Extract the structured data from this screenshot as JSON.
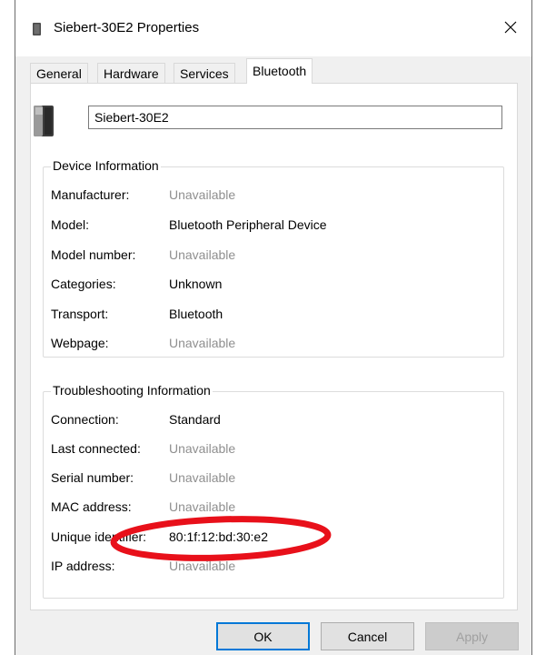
{
  "window": {
    "title": "Siebert-30E2 Properties",
    "title_icon": "bluetooth-device-icon",
    "close_icon": "close-icon"
  },
  "tabs": [
    {
      "label": "General",
      "active": false
    },
    {
      "label": "Hardware",
      "active": false
    },
    {
      "label": "Services",
      "active": false
    },
    {
      "label": "Bluetooth",
      "active": true
    }
  ],
  "device": {
    "icon": "speaker-device-icon",
    "name": "Siebert-30E2"
  },
  "device_information": {
    "legend": "Device Information",
    "rows": [
      {
        "label": "Manufacturer:",
        "value": "Unavailable",
        "muted": true
      },
      {
        "label": "Model:",
        "value": "Bluetooth Peripheral Device",
        "muted": false
      },
      {
        "label": "Model number:",
        "value": "Unavailable",
        "muted": true
      },
      {
        "label": "Categories:",
        "value": "Unknown",
        "muted": false
      },
      {
        "label": "Transport:",
        "value": "Bluetooth",
        "muted": false
      },
      {
        "label": "Webpage:",
        "value": "Unavailable",
        "muted": true
      }
    ]
  },
  "troubleshooting_information": {
    "legend": "Troubleshooting Information",
    "rows": [
      {
        "label": "Connection:",
        "value": "Standard",
        "muted": false
      },
      {
        "label": "Last connected:",
        "value": "Unavailable",
        "muted": true
      },
      {
        "label": "Serial number:",
        "value": "Unavailable",
        "muted": true
      },
      {
        "label": "MAC address:",
        "value": "Unavailable",
        "muted": true
      },
      {
        "label": "Unique identifier:",
        "value": "80:1f:12:bd:30:e2",
        "muted": false
      },
      {
        "label": "IP address:",
        "value": "Unavailable",
        "muted": true
      }
    ]
  },
  "buttons": {
    "ok": "OK",
    "cancel": "Cancel",
    "apply": "Apply"
  },
  "colors": {
    "annotation": "#e8101a",
    "default_button_border": "#0078d7",
    "muted_text": "#8f8f8f"
  }
}
